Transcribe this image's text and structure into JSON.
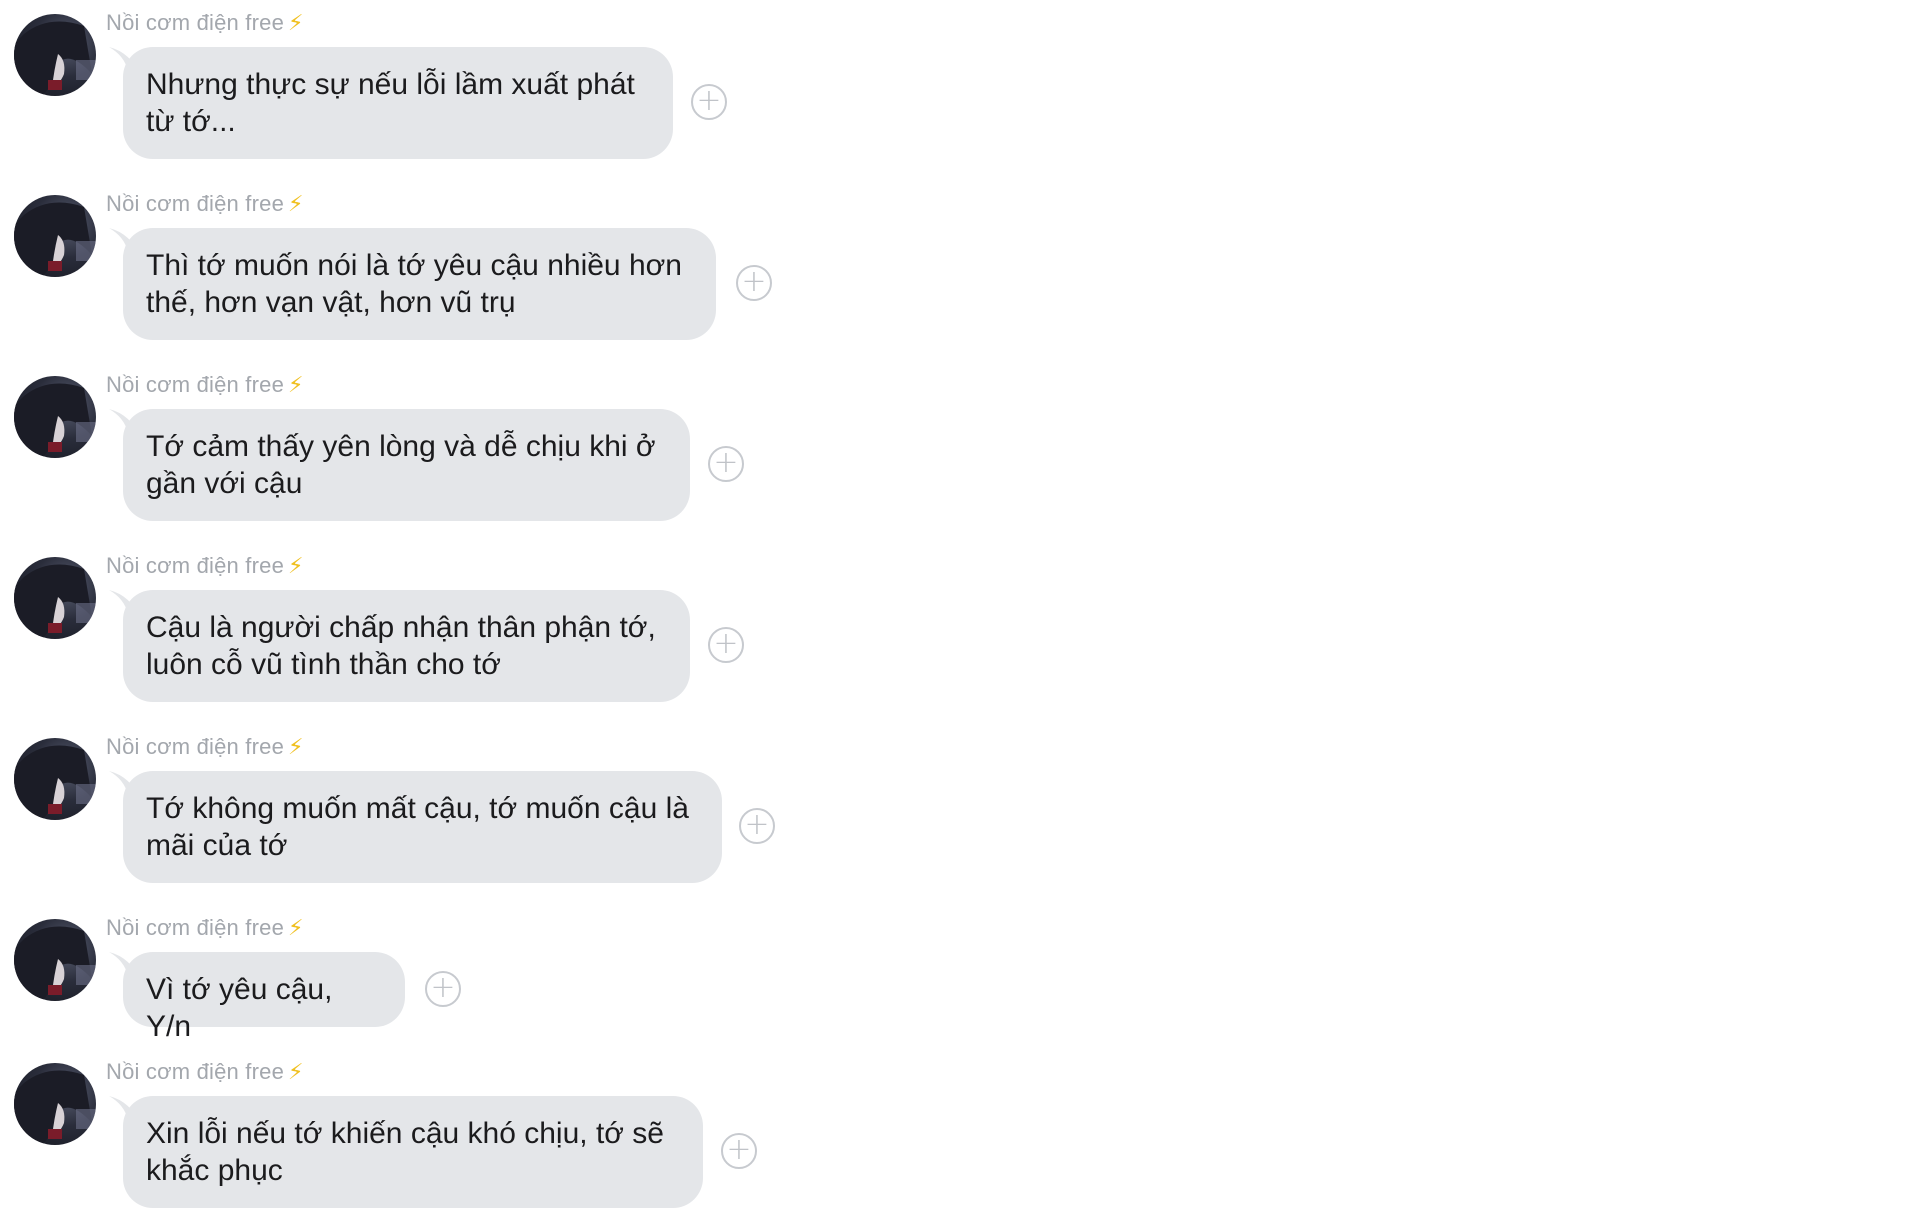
{
  "sender_name": "Nồi cơm điện free",
  "sender_badge": "⚡",
  "messages": [
    {
      "text": "Nhưng thực sự nếu lỗi lầm xuất phát từ tớ..."
    },
    {
      "text": "Thì tớ muốn nói là tớ yêu cậu nhiều hơn thế, hơn vạn vật, hơn vũ trụ"
    },
    {
      "text": "Tớ cảm thấy yên lòng và dễ chịu khi ở gần với cậu"
    },
    {
      "text": "Cậu là người chấp nhận thân phận tớ, luôn cỗ vũ tình thần cho tớ"
    },
    {
      "text": "Tớ không muốn mất cậu, tớ muốn cậu là mãi của tớ"
    },
    {
      "text": "Vì tớ yêu cậu, Y/n"
    },
    {
      "text": "Xin lỗi nếu tớ khiến cậu khó chịu, tớ sẽ khắc phục"
    }
  ],
  "add_reaction_symbol": "+",
  "colors": {
    "bubble": "#e4e6e9",
    "sender_name": "#a3a7ad",
    "badge": "#f0c020",
    "text": "#1b1b1d"
  },
  "icons": {
    "avatar": "anime-avatar",
    "add_reaction": "plus-circle-icon",
    "badge": "lightning-icon"
  }
}
